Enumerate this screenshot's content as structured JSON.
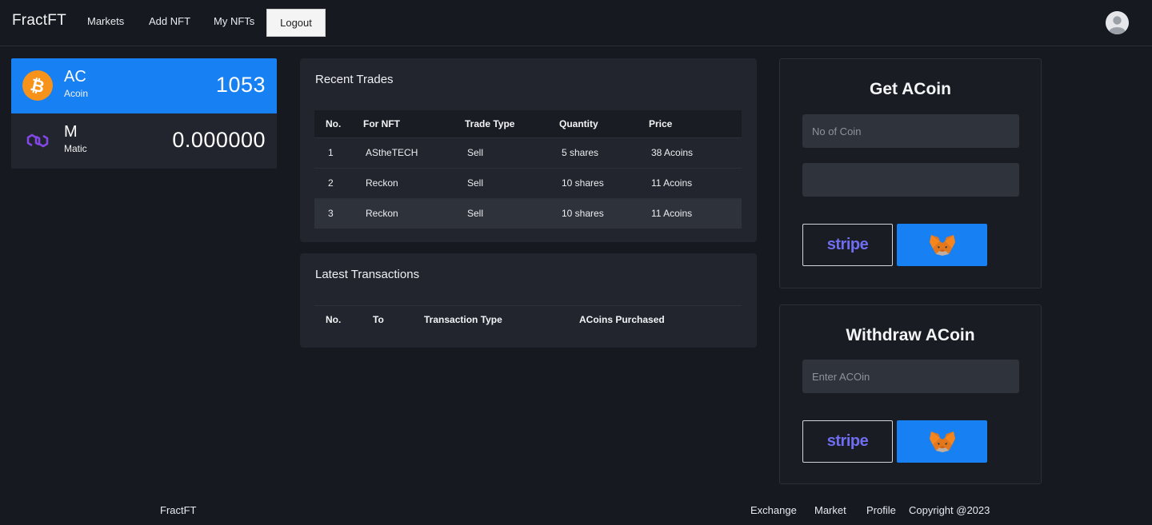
{
  "nav": {
    "brand": "FractFT",
    "links": [
      "Markets",
      "Add NFT",
      "My NFTs"
    ],
    "logout": "Logout"
  },
  "wallet": [
    {
      "code": "AC",
      "name": "Acoin",
      "balance": "1053",
      "icon": "bitcoin-icon",
      "color": "#f7931a"
    },
    {
      "code": "M",
      "name": "Matic",
      "balance": "0.000000",
      "icon": "polygon-icon",
      "color": "#8247e5"
    }
  ],
  "recent_trades": {
    "title": "Recent Trades",
    "columns": [
      "No.",
      "For NFT",
      "Trade Type",
      "Quantity",
      "Price"
    ],
    "rows": [
      [
        "1",
        "AStheTECH",
        "Sell",
        "5 shares",
        "38 Acoins"
      ],
      [
        "2",
        "Reckon",
        "Sell",
        "10 shares",
        "11 Acoins"
      ],
      [
        "3",
        "Reckon",
        "Sell",
        "10 shares",
        "11 Acoins"
      ]
    ]
  },
  "latest_transactions": {
    "title": "Latest Transactions",
    "columns": [
      "No.",
      "To",
      "Transaction Type",
      "ACoins Purchased"
    ],
    "rows": []
  },
  "get_acoin": {
    "title": "Get ACoin",
    "coin_placeholder": "No of Coin",
    "second_value": "",
    "stripe_label": "stripe"
  },
  "withdraw_acoin": {
    "title": "Withdraw ACoin",
    "placeholder": "Enter ACOin",
    "stripe_label": "stripe"
  },
  "footer": {
    "brand": "FractFT",
    "links": [
      "Exchange",
      "Market",
      "Profile"
    ],
    "copyright": "Copyright @2023"
  },
  "colors": {
    "accent": "#1780f3",
    "background": "#161920",
    "panel": "#22252d"
  }
}
